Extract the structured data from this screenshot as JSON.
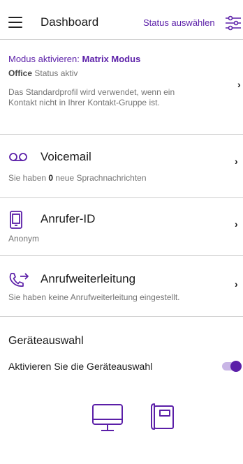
{
  "header": {
    "title": "Dashboard",
    "status_link": "Status auswählen"
  },
  "mode": {
    "prefix": "Modus aktivieren:",
    "name": "Matrix Modus",
    "office_bold": "Office",
    "office_rest": "Status aktiv",
    "description_line1": "Das Standardprofil wird verwendet, wenn ein",
    "description_line2": "Kontakt nicht in Ihrer Kontakt-Gruppe ist."
  },
  "voicemail": {
    "title": "Voicemail",
    "sub_prefix": "Sie haben",
    "count": "0",
    "sub_suffix": "neue Sprachnachrichten"
  },
  "caller_id": {
    "title": "Anrufer-ID",
    "value": "Anonym"
  },
  "forwarding": {
    "title": "Anrufweiterleitung",
    "sub": "Sie haben keine Anrufweiterleitung eingestellt."
  },
  "devices": {
    "title": "Geräteauswahl",
    "toggle_label": "Aktivieren Sie die Geräteauswahl",
    "toggle_on": true
  },
  "colors": {
    "accent": "#5b1fa8"
  },
  "icons": [
    "menu-icon",
    "filter-sliders-icon",
    "voicemail-icon",
    "phone-icon",
    "call-forward-icon",
    "desktop-icon",
    "desk-phone-icon",
    "chevron-right-icon"
  ]
}
